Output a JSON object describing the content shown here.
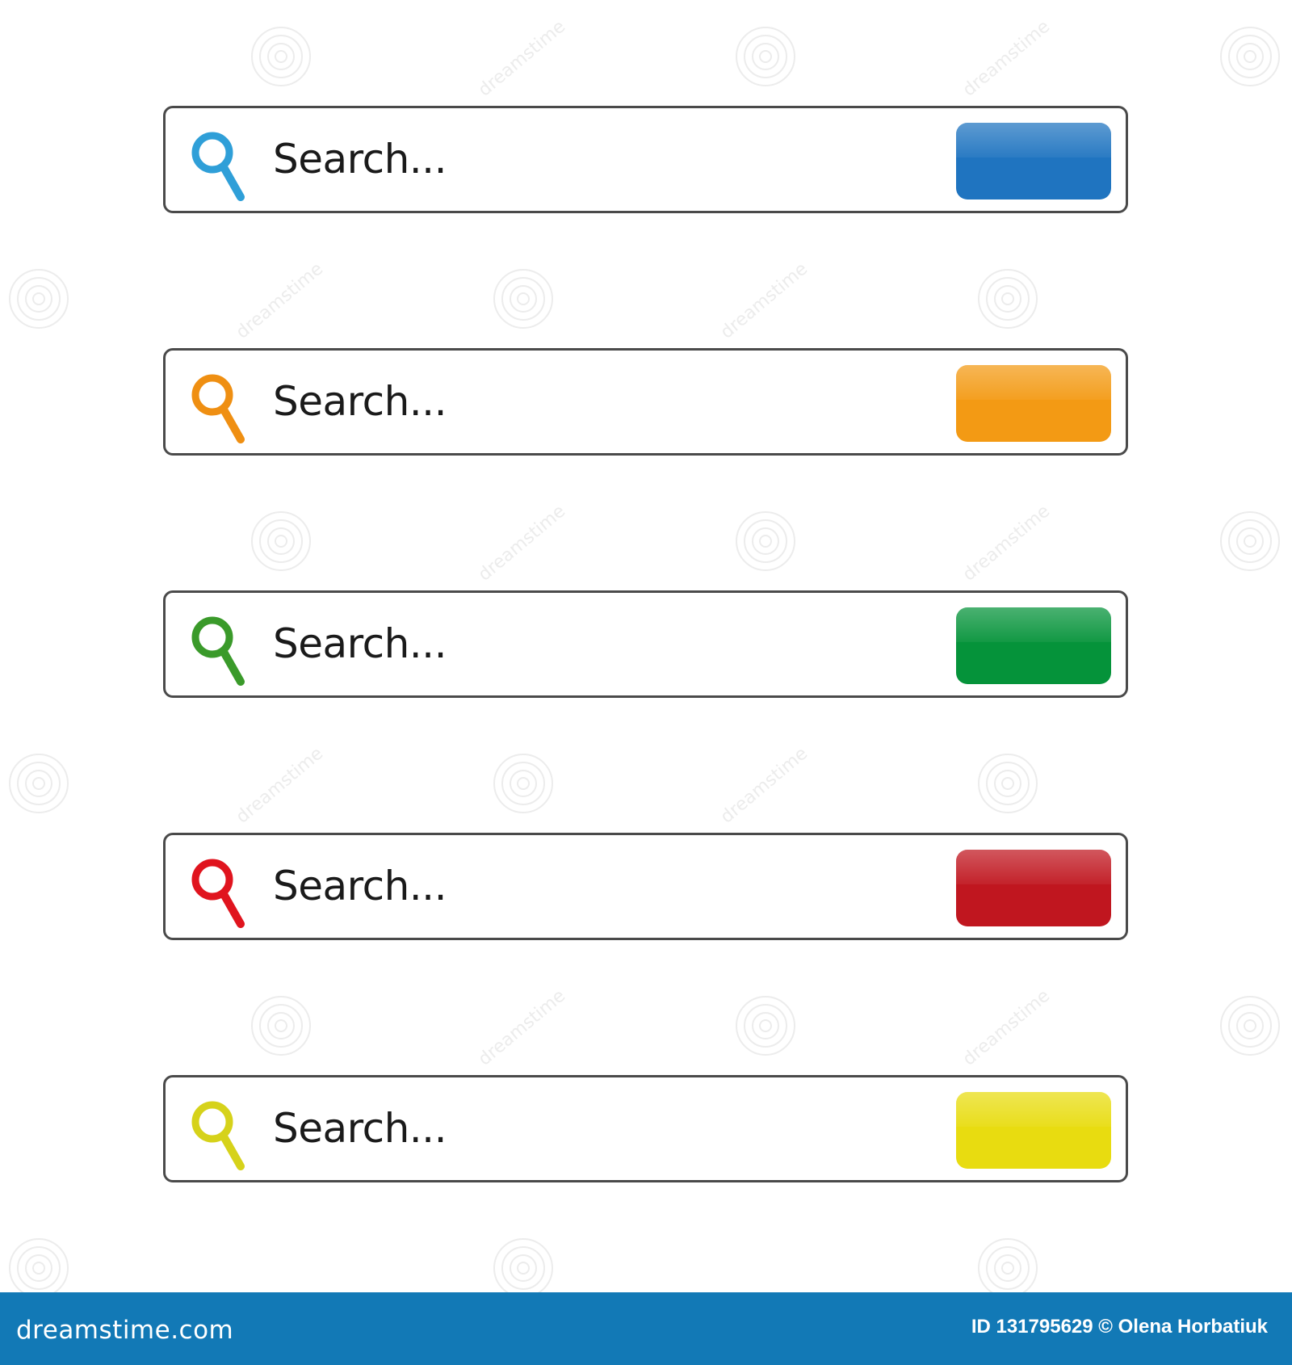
{
  "search_bars": [
    {
      "placeholder": "Search...",
      "color": "#2f9fd8",
      "button_color": "#1f74c0",
      "icon": "magnifier-icon"
    },
    {
      "placeholder": "Search...",
      "color": "#ef8f12",
      "button_color": "#f39a14",
      "icon": "magnifier-icon"
    },
    {
      "placeholder": "Search...",
      "color": "#3a9a2a",
      "button_color": "#05933a",
      "icon": "magnifier-icon"
    },
    {
      "placeholder": "Search...",
      "color": "#e0141e",
      "button_color": "#c0161f",
      "icon": "magnifier-icon"
    },
    {
      "placeholder": "Search...",
      "color": "#d6d21a",
      "button_color": "#e8dc10",
      "icon": "magnifier-icon"
    }
  ],
  "footer": {
    "brand": "dreamstime.com",
    "credit": "ID 131795629 © Olena Horbatiuk",
    "background_color": "#1279b6"
  },
  "watermark": {
    "text": "dreamstime"
  }
}
